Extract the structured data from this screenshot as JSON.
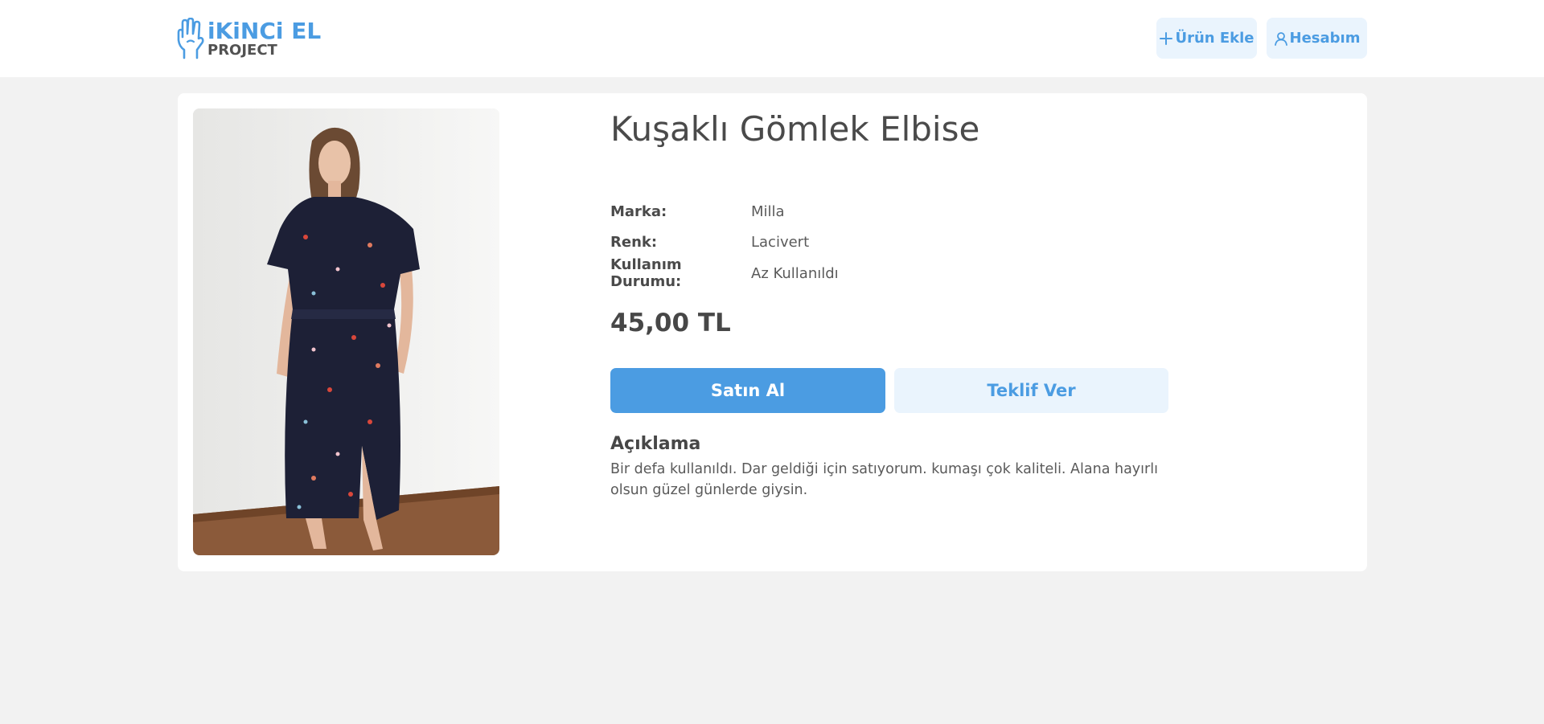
{
  "brand": {
    "name": "iKiNCi EL",
    "sub": "PROJECT",
    "logo_icon": "hand-icon",
    "accent_color": "#4b9ce2"
  },
  "header": {
    "add_product_label": "Ürün Ekle",
    "add_icon": "plus-icon",
    "account_label": "Hesabım",
    "account_icon": "user-icon"
  },
  "product": {
    "title": "Kuşaklı Gömlek Elbise",
    "image_icon": "product-photo",
    "attributes": [
      {
        "key": "Marka:",
        "value": "Milla"
      },
      {
        "key": "Renk:",
        "value": "Lacivert"
      },
      {
        "key": "Kullanım Durumu:",
        "value": "Az Kullanıldı"
      }
    ],
    "price": "45,00 TL",
    "buy_label": "Satın Al",
    "offer_label": "Teklif Ver",
    "description_title": "Açıklama",
    "description": "Bir defa kullanıldı. Dar geldiği için satıyorum. kumaşı çok kaliteli. Alana hayırlı olsun güzel günlerde giysin."
  }
}
